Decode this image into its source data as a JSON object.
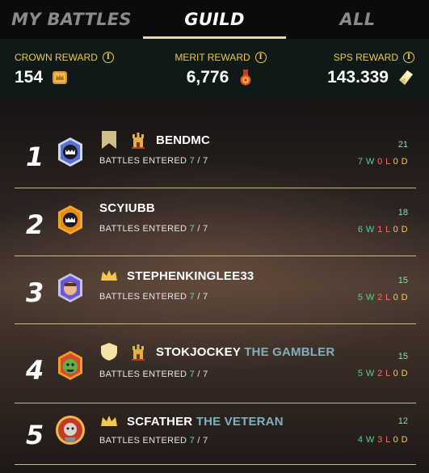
{
  "tabs": [
    {
      "label": "MY BATTLES",
      "active": false
    },
    {
      "label": "GUILD",
      "active": true
    },
    {
      "label": "ALL",
      "active": false
    }
  ],
  "rewards": [
    {
      "label": "CROWN REWARD",
      "value": "154",
      "icon": "crown-token-icon"
    },
    {
      "label": "MERIT REWARD",
      "value": "6,776",
      "icon": "merit-medal-icon"
    },
    {
      "label": "SPS REWARD",
      "value": "143.339",
      "icon": "sps-crystal-icon"
    }
  ],
  "battles_entered_label": "BATTLES ENTERED",
  "players": [
    {
      "rank": "1",
      "name": "BENDMC",
      "title": "",
      "entered": "7",
      "total": "7",
      "score": "21",
      "w": "7",
      "l": "0",
      "d": "0"
    },
    {
      "rank": "2",
      "name": "SCYIUBB",
      "title": "",
      "entered": "7",
      "total": "7",
      "score": "18",
      "w": "6",
      "l": "1",
      "d": "0"
    },
    {
      "rank": "3",
      "name": "STEPHENKINGLEE33",
      "title": "",
      "entered": "7",
      "total": "7",
      "score": "15",
      "w": "5",
      "l": "2",
      "d": "0"
    },
    {
      "rank": "4",
      "name": "STOKJOCKEY",
      "title": "THE GAMBLER",
      "entered": "7",
      "total": "7",
      "score": "15",
      "w": "5",
      "l": "2",
      "d": "0"
    },
    {
      "rank": "5",
      "name": "SCFATHER",
      "title": "THE VETERAN",
      "entered": "7",
      "total": "7",
      "score": "12",
      "w": "4",
      "l": "3",
      "d": "0"
    }
  ],
  "colors": {
    "accent_gold": "#f0c94a",
    "win": "#4fd98f",
    "loss": "#ff6b6b",
    "draw": "#ffc94a",
    "title_blue": "#7fb0bf"
  }
}
